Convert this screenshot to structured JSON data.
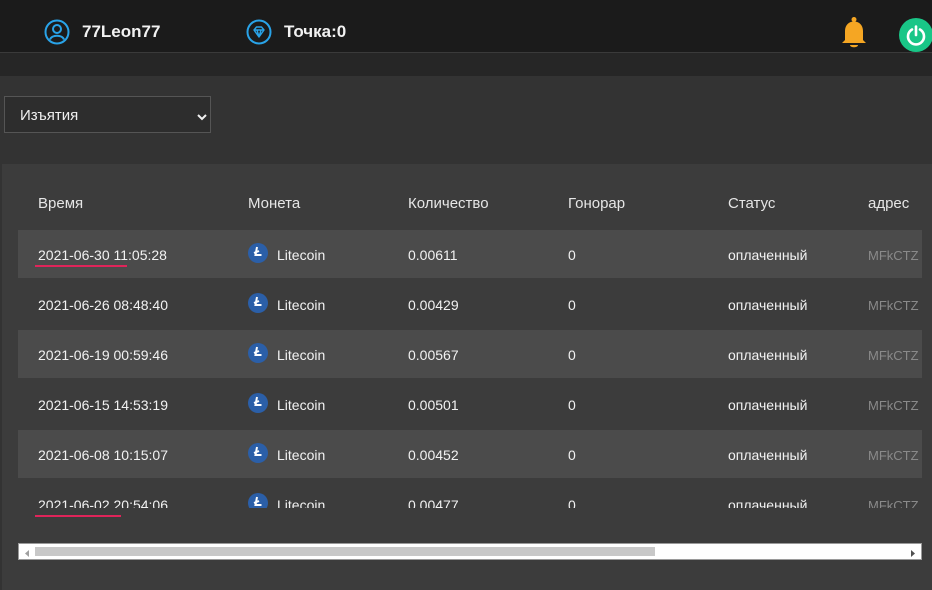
{
  "header": {
    "username": "77Leon77",
    "points": "Точка:0",
    "icons": [
      "user-circle-icon",
      "diamond-icon",
      "bell-icon",
      "power-icon"
    ],
    "colors": {
      "accent": "#29a3e8",
      "bell": "#f5a623",
      "power": "#19c687"
    }
  },
  "filter": {
    "selected": "Изъятия"
  },
  "table": {
    "columns": [
      "Время",
      "Монета",
      "Количество",
      "Гонорар",
      "Статус",
      "адрес"
    ],
    "rows": [
      {
        "time": "2021-06-30 11:05:28",
        "coin": "Litecoin",
        "amount": "0.00611",
        "fee": "0",
        "status": "оплаченный",
        "address": "MFkCTZ"
      },
      {
        "time": "2021-06-26 08:48:40",
        "coin": "Litecoin",
        "amount": "0.00429",
        "fee": "0",
        "status": "оплаченный",
        "address": "MFkCTZ"
      },
      {
        "time": "2021-06-19 00:59:46",
        "coin": "Litecoin",
        "amount": "0.00567",
        "fee": "0",
        "status": "оплаченный",
        "address": "MFkCTZ"
      },
      {
        "time": "2021-06-15 14:53:19",
        "coin": "Litecoin",
        "amount": "0.00501",
        "fee": "0",
        "status": "оплаченный",
        "address": "MFkCTZ"
      },
      {
        "time": "2021-06-08 10:15:07",
        "coin": "Litecoin",
        "amount": "0.00452",
        "fee": "0",
        "status": "оплаченный",
        "address": "MFkCTZ"
      },
      {
        "time": "2021-06-02 20:54:06",
        "coin": "Litecoin",
        "amount": "0.00477",
        "fee": "0",
        "status": "оплаченный",
        "address": "MFkCTZ"
      }
    ]
  }
}
